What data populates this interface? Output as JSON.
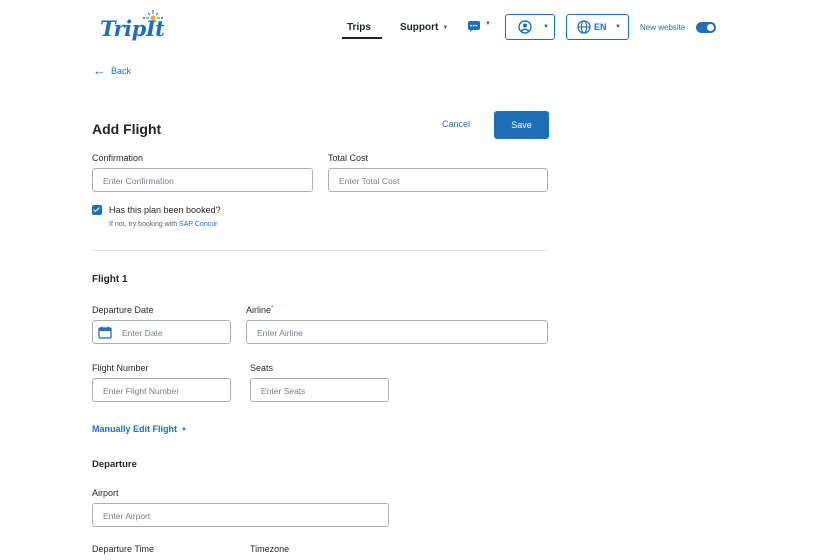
{
  "header": {
    "logo_text": "TripIt",
    "nav": {
      "trips": "Trips",
      "support": "Support"
    },
    "language": "EN",
    "new_website_label": "New website",
    "new_website_enabled": true
  },
  "back_label": "Back",
  "form": {
    "title": "Add Flight",
    "cancel_label": "Cancel",
    "save_label": "Save",
    "confirmation": {
      "label": "Confirmation",
      "placeholder": "Enter Confirmation"
    },
    "total_cost": {
      "label": "Total Cost",
      "placeholder": "Enter Total Cost"
    },
    "booked": {
      "checked": true,
      "label": "Has this plan been booked?",
      "hint_prefix": "If not, try booking with",
      "hint_link": "SAP Concur"
    },
    "flight_section_title": "Flight 1",
    "departure_date": {
      "label": "Departure Date",
      "placeholder": "Enter Date"
    },
    "airline": {
      "label": "Airline",
      "required_mark": "*",
      "placeholder": "Enter Airline"
    },
    "flight_number": {
      "label": "Flight Number",
      "placeholder": "Enter Flight Number"
    },
    "seats": {
      "label": "Seats",
      "placeholder": "Enter Seats"
    },
    "manual_edit_label": "Manually Edit Flight",
    "departure_section_title": "Departure",
    "airport": {
      "label": "Airport",
      "placeholder": "Enter Airport"
    },
    "departure_time_label": "Departure Time",
    "timezone_label": "Timezone"
  },
  "colors": {
    "accent": "#1e6fb9",
    "text": "#1f2428",
    "border": "#a9afb5",
    "required": "#e25b5b"
  },
  "icons": [
    "back-arrow-icon",
    "message-icon",
    "user-circle-icon",
    "globe-icon",
    "calendar-icon",
    "check-icon",
    "chevron-down-icon"
  ]
}
